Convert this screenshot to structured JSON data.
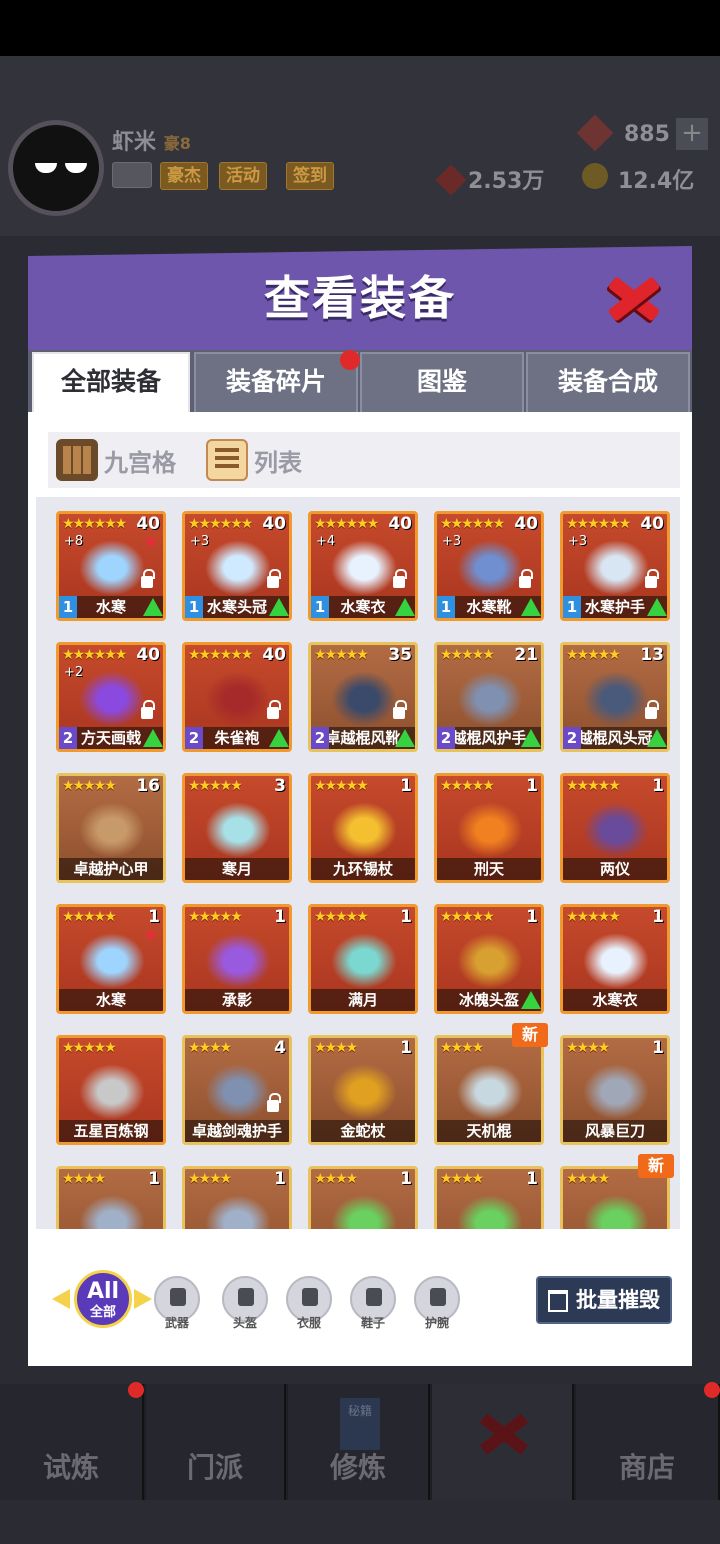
{
  "player": {
    "name": "虾米",
    "vip": "豪8",
    "gems": "885",
    "power": "2.53万",
    "coins": "12.4亿"
  },
  "header_buttons": [
    "豪杰",
    "活动",
    "签到"
  ],
  "modal": {
    "title": "查看装备"
  },
  "tabs": [
    {
      "label": "全部装备"
    },
    {
      "label": "装备碎片"
    },
    {
      "label": "图鉴"
    },
    {
      "label": "装备合成"
    }
  ],
  "view_modes": {
    "grid": "九宫格",
    "list": "列表"
  },
  "items": [
    {
      "stars": "★★★★★★",
      "qty": "40",
      "plus": "+8",
      "name": "水寒",
      "lvl": "1",
      "up": true,
      "lock": true,
      "heart": true,
      "rarity": "r1",
      "art_color": "#9fd4ff"
    },
    {
      "stars": "★★★★★★",
      "qty": "40",
      "plus": "+3",
      "name": "水寒头冠",
      "lvl": "1",
      "up": true,
      "lock": true,
      "rarity": "r1",
      "art_color": "#cfeaff"
    },
    {
      "stars": "★★★★★★",
      "qty": "40",
      "plus": "+4",
      "name": "水寒衣",
      "lvl": "1",
      "up": true,
      "lock": true,
      "rarity": "r1",
      "art_color": "#e8f2ff"
    },
    {
      "stars": "★★★★★★",
      "qty": "40",
      "plus": "+3",
      "name": "水寒靴",
      "lvl": "1",
      "up": true,
      "lock": true,
      "rarity": "r1",
      "art_color": "#6f8fd0"
    },
    {
      "stars": "★★★★★★",
      "qty": "40",
      "plus": "+3",
      "name": "水寒护手",
      "lvl": "1",
      "up": true,
      "lock": true,
      "rarity": "r1",
      "art_color": "#d8e6f4"
    },
    {
      "stars": "★★★★★★",
      "qty": "40",
      "plus": "+2",
      "name": "方天画戟",
      "lvl": "2",
      "up": true,
      "lock": true,
      "rarity": "r1",
      "art_color": "#8a4ae0"
    },
    {
      "stars": "★★★★★★",
      "qty": "40",
      "name": "朱雀袍",
      "lvl": "2",
      "up": true,
      "lock": true,
      "rarity": "r1",
      "art_color": "#a62a2a"
    },
    {
      "stars": "★★★★★",
      "qty": "35",
      "name": "卓越棍风靴",
      "lvl": "2",
      "up": true,
      "lock": true,
      "rarity": "r2",
      "art_color": "#3a4a6a"
    },
    {
      "stars": "★★★★★",
      "qty": "21",
      "name": "越棍风护手",
      "lvl": "2",
      "up": true,
      "lock": false,
      "rarity": "r2",
      "art_color": "#8090b0"
    },
    {
      "stars": "★★★★★",
      "qty": "13",
      "name": "越棍风头冠",
      "lvl": "2",
      "up": true,
      "lock": true,
      "rarity": "r2",
      "art_color": "#4a5a7a"
    },
    {
      "stars": "★★★★★",
      "qty": "16",
      "name": "卓越护心甲",
      "rarity": "r2",
      "art_color": "#c89a6a"
    },
    {
      "stars": "★★★★★",
      "qty": "3",
      "name": "寒月",
      "rarity": "r1",
      "art_color": "#a8e0e8"
    },
    {
      "stars": "★★★★★",
      "qty": "1",
      "name": "九环锡杖",
      "rarity": "r1",
      "art_color": "#f4c030"
    },
    {
      "stars": "★★★★★",
      "qty": "1",
      "name": "刑天",
      "rarity": "r1",
      "art_color": "#f08020"
    },
    {
      "stars": "★★★★★",
      "qty": "1",
      "name": "两仪",
      "rarity": "r1",
      "art_color": "#6a4a9a"
    },
    {
      "stars": "★★★★★",
      "qty": "1",
      "name": "水寒",
      "heart": true,
      "rarity": "r1",
      "art_color": "#9fd4ff"
    },
    {
      "stars": "★★★★★",
      "qty": "1",
      "name": "承影",
      "rarity": "r1",
      "art_color": "#9a5ae0"
    },
    {
      "stars": "★★★★★",
      "qty": "1",
      "name": "满月",
      "rarity": "r1",
      "art_color": "#7ad8d0"
    },
    {
      "stars": "★★★★★",
      "qty": "1",
      "name": "冰魄头盔",
      "up": true,
      "rarity": "r1",
      "art_color": "#d8a030"
    },
    {
      "stars": "★★★★★",
      "qty": "1",
      "name": "水寒衣",
      "rarity": "r1",
      "art_color": "#e8f2ff"
    },
    {
      "stars": "★★★★★",
      "qty": "",
      "name": "五星百炼钢",
      "rarity": "r1",
      "art_color": "#c8c8c8"
    },
    {
      "stars": "★★★★",
      "qty": "4",
      "name": "卓越剑魂护手",
      "lock": true,
      "rarity": "r2",
      "art_color": "#8090b0"
    },
    {
      "stars": "★★★★",
      "qty": "1",
      "name": "金蛇杖",
      "rarity": "r2",
      "art_color": "#e0a020"
    },
    {
      "stars": "★★★★",
      "qty": "",
      "name": "天机棍",
      "new": true,
      "rarity": "r2",
      "art_color": "#c8d8e0"
    },
    {
      "stars": "★★★★",
      "qty": "1",
      "name": "风暴巨刀",
      "rarity": "r2",
      "art_color": "#a0a8b8"
    },
    {
      "stars": "★★★★",
      "qty": "1",
      "name": "",
      "rarity": "r2",
      "art_color": "#a0b0c8"
    },
    {
      "stars": "★★★★",
      "qty": "1",
      "name": "",
      "rarity": "r2",
      "art_color": "#a0b0c8"
    },
    {
      "stars": "★★★★",
      "qty": "1",
      "name": "",
      "rarity": "r2",
      "art_color": "#6ad060"
    },
    {
      "stars": "★★★★",
      "qty": "1",
      "name": "",
      "rarity": "r2",
      "art_color": "#6ad060"
    },
    {
      "stars": "★★★★",
      "qty": "",
      "name": "",
      "new": true,
      "rarity": "r2",
      "art_color": "#6ad060"
    }
  ],
  "new_label": "新",
  "filters": {
    "all_top": "All",
    "all_bottom": "全部",
    "types": [
      "武器",
      "头盔",
      "衣服",
      "鞋子",
      "护腕"
    ]
  },
  "batch_destroy": "批量摧毁",
  "bottom_nav": [
    "试炼",
    "门派",
    "修炼",
    "",
    "商店"
  ],
  "bottom_nav_sub": "秘籍",
  "colors": {
    "modal_header": "#6f56ad",
    "close": "#e0242c",
    "destroy_btn": "#2d3a55"
  }
}
